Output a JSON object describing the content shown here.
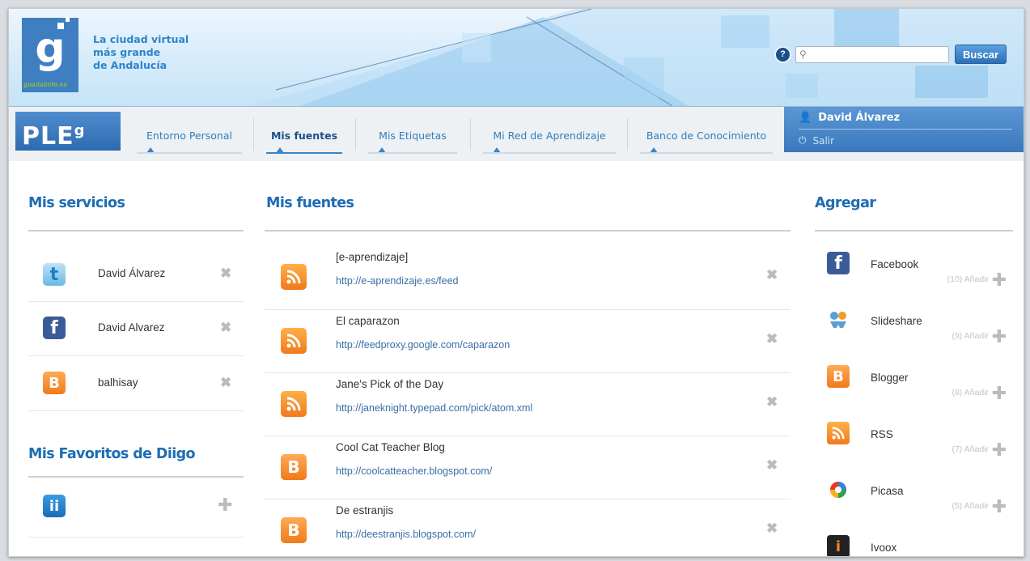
{
  "header": {
    "logo_letter": "g",
    "logo_subtext": "guadalinfo.es",
    "tagline": [
      "La ciudad virtual",
      "más grande",
      "de Andalucía"
    ],
    "search_placeholder": "",
    "search_button": "Buscar",
    "help_label": "?"
  },
  "nav": {
    "brand": "PLE",
    "brand_sup": "g",
    "tabs": [
      {
        "label": "Entorno Personal"
      },
      {
        "label": "Mis fuentes"
      },
      {
        "label": "Mis Etiquetas"
      },
      {
        "label": "Mi Red de Aprendizaje"
      },
      {
        "label": "Banco de Conocimiento"
      }
    ],
    "active_tab": "Mis fuentes",
    "user_name": "David Álvarez",
    "logout_label": "Salir"
  },
  "services": {
    "title": "Mis servicios",
    "items": [
      {
        "icon": "twitter-icon",
        "name": "David Álvarez"
      },
      {
        "icon": "facebook-icon",
        "name": "David Alvarez"
      },
      {
        "icon": "blogger-icon",
        "name": "balhisay"
      }
    ]
  },
  "diigo": {
    "title": "Mis Favoritos de Diigo",
    "icon": "diigo-icon"
  },
  "feeds": {
    "title": "Mis fuentes",
    "items": [
      {
        "icon": "rss-icon",
        "title": "[e-aprendizaje]",
        "url": "http://e-aprendizaje.es/feed"
      },
      {
        "icon": "rss-icon",
        "title": "El caparazon",
        "url": "http://feedproxy.google.com/caparazon"
      },
      {
        "icon": "rss-icon",
        "title": "Jane's Pick of the Day",
        "url": "http://janeknight.typepad.com/pick/atom.xml"
      },
      {
        "icon": "blogger-icon",
        "title": "Cool Cat Teacher Blog",
        "url": "http://coolcatteacher.blogspot.com/"
      },
      {
        "icon": "blogger-icon",
        "title": "De estranjis",
        "url": "http://deestranjis.blogspot.com/"
      }
    ]
  },
  "add": {
    "title": "Agregar",
    "items": [
      {
        "icon": "facebook-icon",
        "name": "Facebook",
        "count": "(10) Añadir"
      },
      {
        "icon": "slideshare-icon",
        "name": "Slideshare",
        "count": "(9) Añadir"
      },
      {
        "icon": "blogger-icon",
        "name": "Blogger",
        "count": "(8) Añadir"
      },
      {
        "icon": "rss-icon",
        "name": "RSS",
        "count": "(7) Añadir"
      },
      {
        "icon": "picasa-icon",
        "name": "Picasa",
        "count": "(5) Añadir"
      },
      {
        "icon": "ivoox-icon",
        "name": "Ivoox",
        "count": ""
      }
    ]
  },
  "colors": {
    "brand_blue": "#2f84c8",
    "title_blue": "#1e6db5",
    "rss_orange": "#f07a1c",
    "facebook_blue": "#3b5a98"
  }
}
